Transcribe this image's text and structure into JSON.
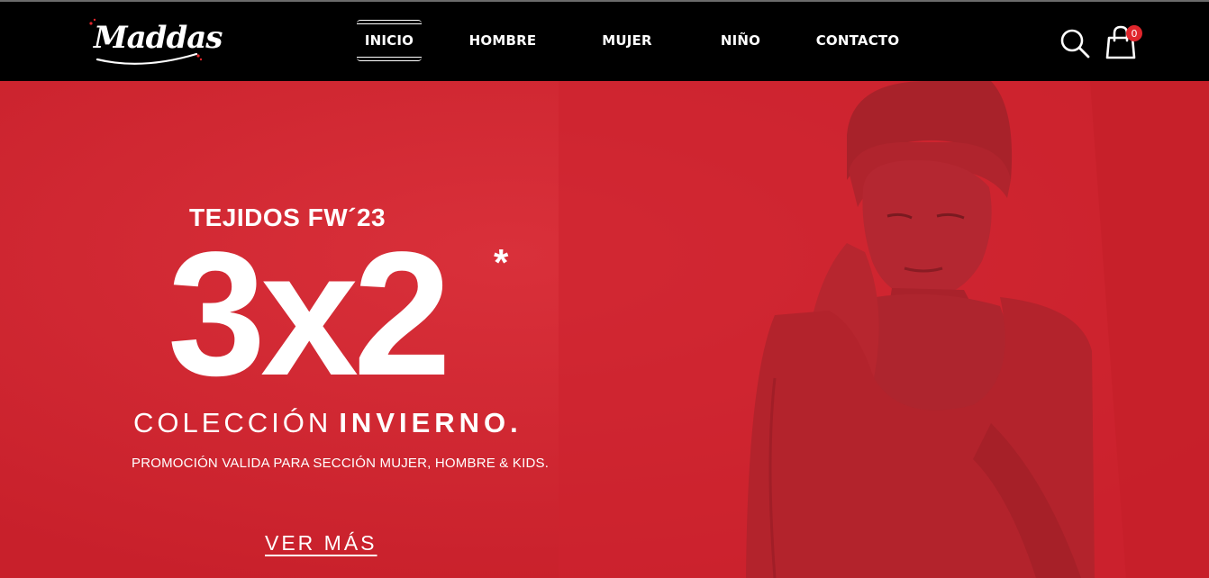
{
  "brand": {
    "logo_text": "Maddas",
    "accent": "#e0262c"
  },
  "nav": {
    "items": [
      {
        "label": "INICIO",
        "active": true
      },
      {
        "label": "HOMBRE",
        "active": false
      },
      {
        "label": "MUJER",
        "active": false
      },
      {
        "label": "NIÑO",
        "active": false
      },
      {
        "label": "CONTACTO",
        "active": false
      }
    ]
  },
  "header_actions": {
    "search_icon": "search-icon",
    "cart_icon": "shopping-bag-icon",
    "cart_count": "0"
  },
  "hero": {
    "background": "#d12631",
    "subtitle": "TEJIDOS FW´23",
    "promo": "3x2",
    "asterisk": "*",
    "collection_light": "COLECCIÓN",
    "collection_bold": "INVIERNO.",
    "validity": "PROMOCIÓN VALIDA PARA SECCIÓN MUJER, HOMBRE & KIDS.",
    "cta_label": "VER MÁS"
  }
}
